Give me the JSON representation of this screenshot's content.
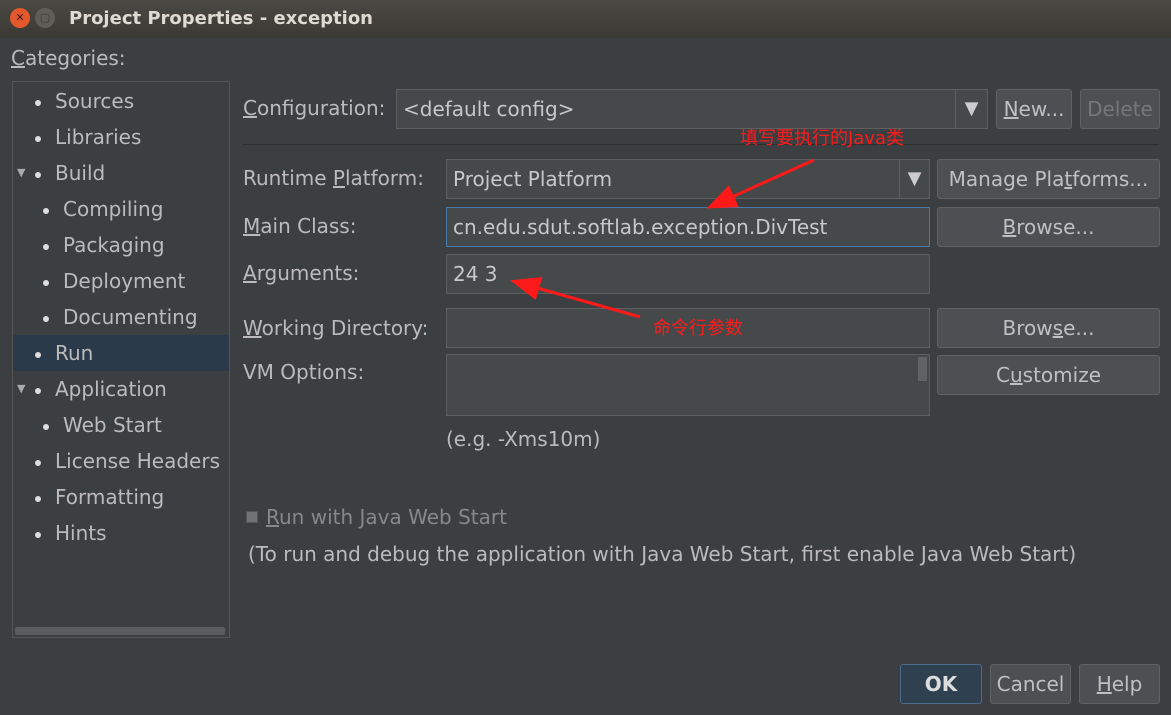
{
  "window": {
    "title": "Project Properties - exception"
  },
  "categories": {
    "label_u": "C",
    "label_rest": "ategories:",
    "items": [
      {
        "label": "Sources"
      },
      {
        "label": "Libraries"
      },
      {
        "label": "Build"
      },
      {
        "label": "Compiling"
      },
      {
        "label": "Packaging"
      },
      {
        "label": "Deployment"
      },
      {
        "label": "Documenting"
      },
      {
        "label": "Run"
      },
      {
        "label": "Application"
      },
      {
        "label": "Web Start"
      },
      {
        "label": "License Headers"
      },
      {
        "label": "Formatting"
      },
      {
        "label": "Hints"
      }
    ]
  },
  "config": {
    "label_u": "C",
    "label_rest": "onfiguration:",
    "value": "<default config>",
    "new_u": "N",
    "new_rest": "ew...",
    "delete": "Delete"
  },
  "runtime": {
    "label_a": "Runtime ",
    "label_u": "P",
    "label_b": "latform:",
    "value": "Project Platform",
    "manage_a": "Manage Pla",
    "manage_u": "t",
    "manage_b": "forms..."
  },
  "main_class": {
    "label_u": "M",
    "label_rest": "ain Class:",
    "value": "cn.edu.sdut.softlab.exception.DivTest",
    "browse_u": "B",
    "browse_rest": "rowse..."
  },
  "arguments": {
    "label_u": "A",
    "label_rest": "rguments:",
    "value": "24 3"
  },
  "working_dir": {
    "label_u": "W",
    "label_rest": "orking Directory:",
    "value": "",
    "browse_a": "Brow",
    "browse_u": "s",
    "browse_b": "e..."
  },
  "vm": {
    "label": "VM Options:",
    "value": "",
    "hint": "(e.g. -Xms10m)",
    "customize_a": "C",
    "customize_u": "u",
    "customize_b": "stomize"
  },
  "webstart": {
    "label_u": "R",
    "label_rest": "un with Java Web Start",
    "checked": false,
    "note": "(To run and debug the application with Java Web Start, first enable Java Web Start)"
  },
  "annotations": {
    "main_class": "填写要执行的Java类",
    "arguments": "命令行参数"
  },
  "footer": {
    "ok": "OK",
    "cancel": "Cancel",
    "help_u": "H",
    "help_rest": "elp"
  }
}
